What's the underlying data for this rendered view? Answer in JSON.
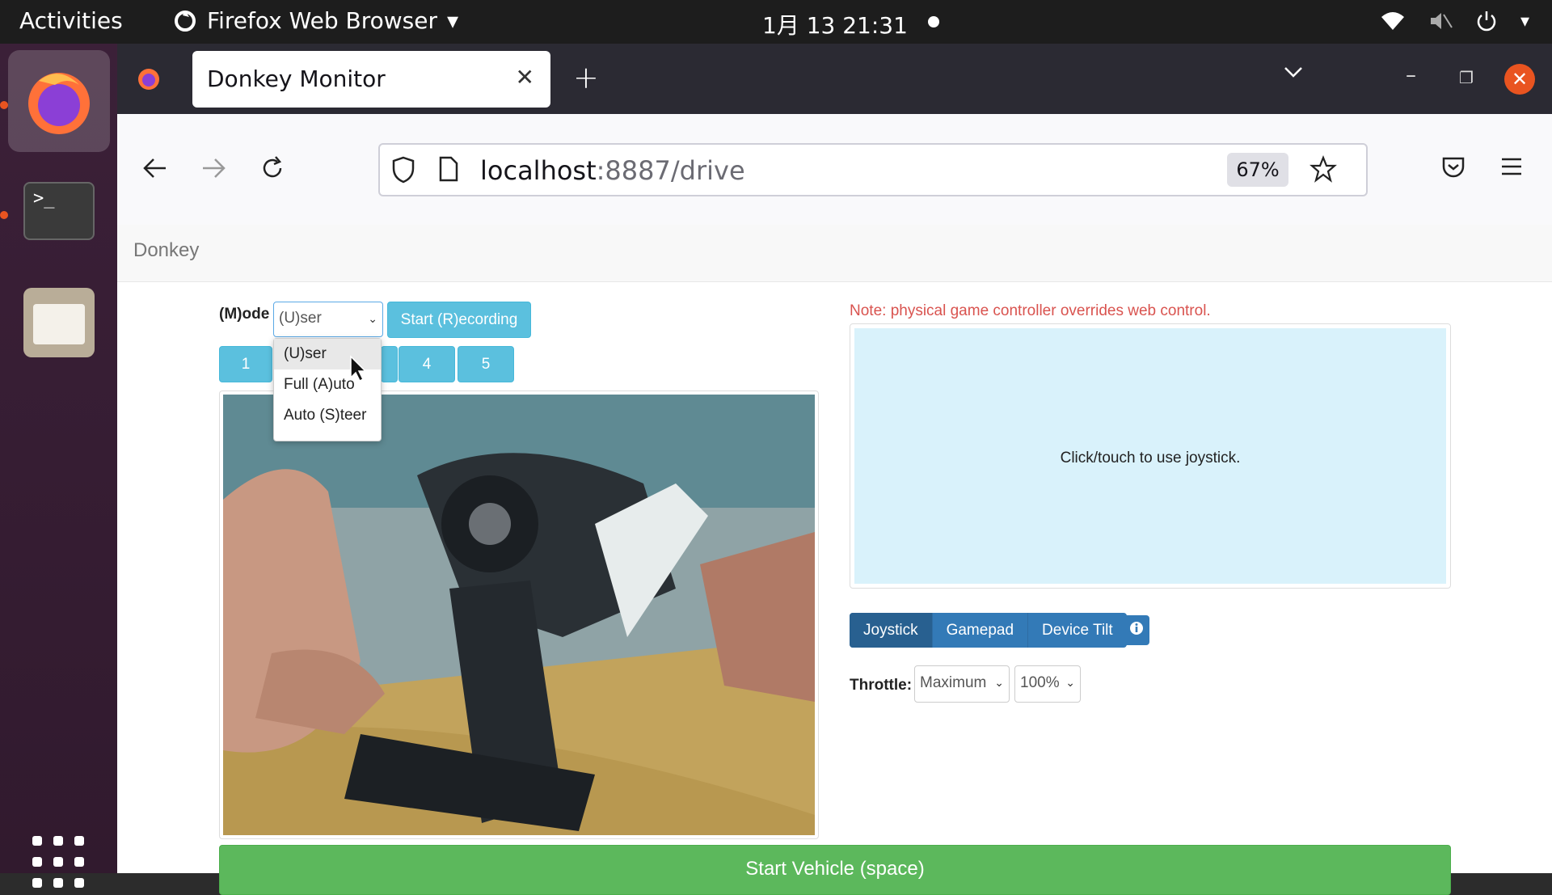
{
  "topbar": {
    "activities": "Activities",
    "app_name": "Firefox Web Browser",
    "clock": "1月 13  21:31"
  },
  "dock": {
    "items": [
      "firefox-icon",
      "terminal-icon",
      "files-icon",
      "show-apps-icon"
    ]
  },
  "browser": {
    "tab_title": "Donkey Monitor",
    "url_host": "localhost",
    "url_rest": ":8887/drive",
    "zoom": "67%"
  },
  "page": {
    "brand": "Donkey",
    "mode_label": "(M)ode",
    "mode_value": "(U)ser",
    "mode_options": [
      "(U)ser",
      "Full (A)uto",
      "Auto (S)teer"
    ],
    "record_button": "Start (R)ecording",
    "number_buttons": [
      "1",
      "4",
      "5"
    ],
    "note": "Note: physical game controller overrides web control.",
    "joystick_hint": "Click/touch to use joystick.",
    "control_tabs": [
      "Joystick",
      "Gamepad",
      "Device Tilt"
    ],
    "throttle_label": "Throttle:",
    "throttle_mode": "Maximum",
    "throttle_value": "100%",
    "start_button": "Start Vehicle (space)"
  },
  "colors": {
    "accent_orange": "#e95420",
    "info_blue": "#5bc0de",
    "primary_blue": "#337ab7",
    "success_green": "#5cb85c",
    "note_red": "#d9534f",
    "joystick_bg": "#d9f2fb"
  }
}
